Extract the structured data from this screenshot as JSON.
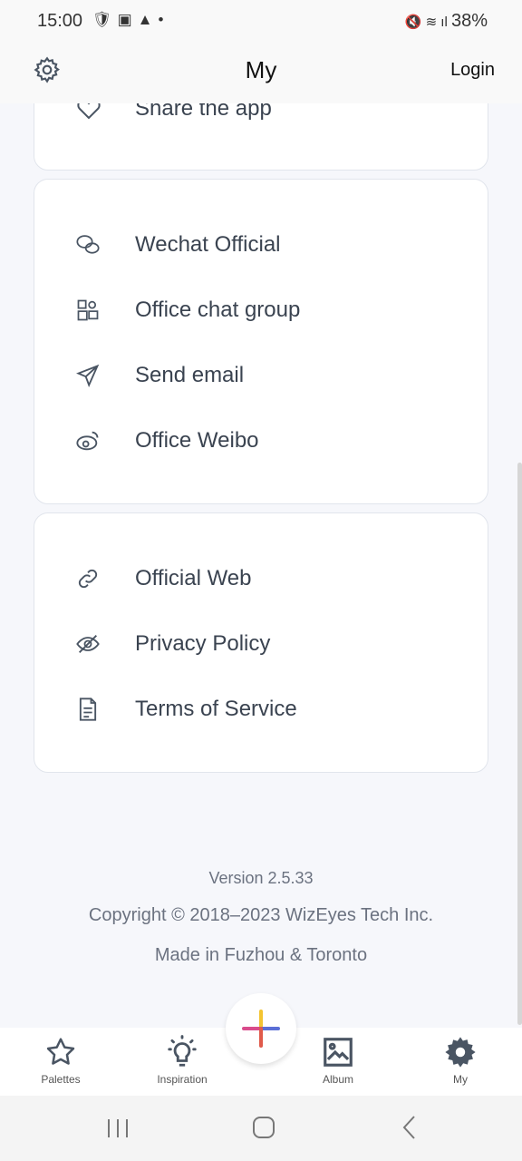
{
  "status": {
    "time": "15:00",
    "battery": "38%"
  },
  "header": {
    "title": "My",
    "login": "Login"
  },
  "card1": {
    "items": [
      {
        "label": "Share the app",
        "icon": "heart-icon"
      }
    ]
  },
  "card2": {
    "items": [
      {
        "label": "Wechat Official",
        "icon": "wechat-icon"
      },
      {
        "label": "Office chat group",
        "icon": "chat-group-icon"
      },
      {
        "label": "Send email",
        "icon": "send-icon"
      },
      {
        "label": "Office Weibo",
        "icon": "weibo-icon"
      }
    ]
  },
  "card3": {
    "items": [
      {
        "label": "Official Web",
        "icon": "link-icon"
      },
      {
        "label": "Privacy Policy",
        "icon": "eye-off-icon"
      },
      {
        "label": "Terms of Service",
        "icon": "document-icon"
      }
    ]
  },
  "footer": {
    "version": "Version 2.5.33",
    "copyright": "Copyright © 2018–2023 WizEyes Tech Inc.",
    "made": "Made in Fuzhou & Toronto"
  },
  "tabs": [
    {
      "label": "Palettes"
    },
    {
      "label": "Inspiration"
    },
    {
      "label": "Album"
    },
    {
      "label": "My"
    }
  ],
  "colors": {
    "icon": "#4a5563",
    "fab_plus": [
      "#f4c430",
      "#d94c8c",
      "#5b6fd6",
      "#e05a4a"
    ]
  }
}
